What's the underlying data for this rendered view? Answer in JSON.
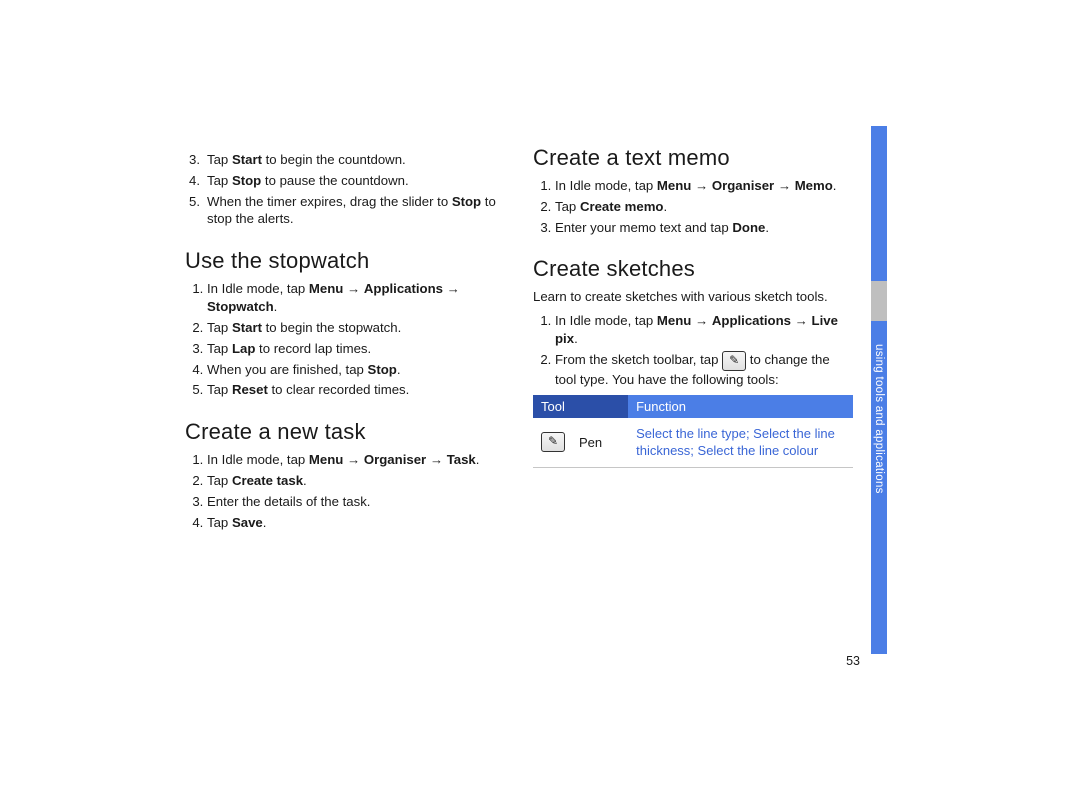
{
  "section_tab": "using tools and applications",
  "page_number": "53",
  "left_col": {
    "timer_steps": [
      "Tap <b>Start</b> to begin the countdown.",
      "Tap <b>Stop</b> to pause the countdown.",
      "When the timer expires, drag the slider to <b>Stop</b> to stop the alerts."
    ],
    "stopwatch_heading": "Use the stopwatch",
    "stopwatch_steps": [
      "In Idle mode, tap <b>Menu</b> → <b>Applications</b> → <b>Stopwatch</b>.",
      "Tap <b>Start</b> to begin the stopwatch.",
      "Tap <b>Lap</b> to record lap times.",
      "When you are finished, tap <b>Stop</b>.",
      "Tap <b>Reset</b> to clear recorded times."
    ],
    "task_heading": "Create a new task",
    "task_steps": [
      "In Idle mode, tap <b>Menu</b>  → <b>Organiser</b> → <b>Task</b>.",
      "Tap <b>Create task</b>.",
      "Enter the details of the task.",
      "Tap <b>Save</b>."
    ]
  },
  "right_col": {
    "memo_heading": "Create a text memo",
    "memo_steps": [
      "In Idle mode, tap <b>Menu</b> → <b>Organiser</b> → <b>Memo</b>.",
      "Tap <b>Create memo</b>.",
      "Enter your memo text and tap <b>Done</b>."
    ],
    "sketch_heading": "Create sketches",
    "sketch_intro": "Learn to create sketches with various sketch tools.",
    "sketch_steps": [
      "In Idle mode, tap <b>Menu</b> → <b>Applications</b> → <b>Live pix</b>.",
      "From the sketch toolbar, tap <span class='pen-icon' data-name='pen-icon' data-interactable='false'>✎</span> to change the tool type. You have the following tools:"
    ],
    "table": {
      "head_tool": "Tool",
      "head_func": "Function",
      "row_tool": "Pen",
      "row_func": "Select the line type; Select the line thickness; Select the line colour"
    }
  }
}
